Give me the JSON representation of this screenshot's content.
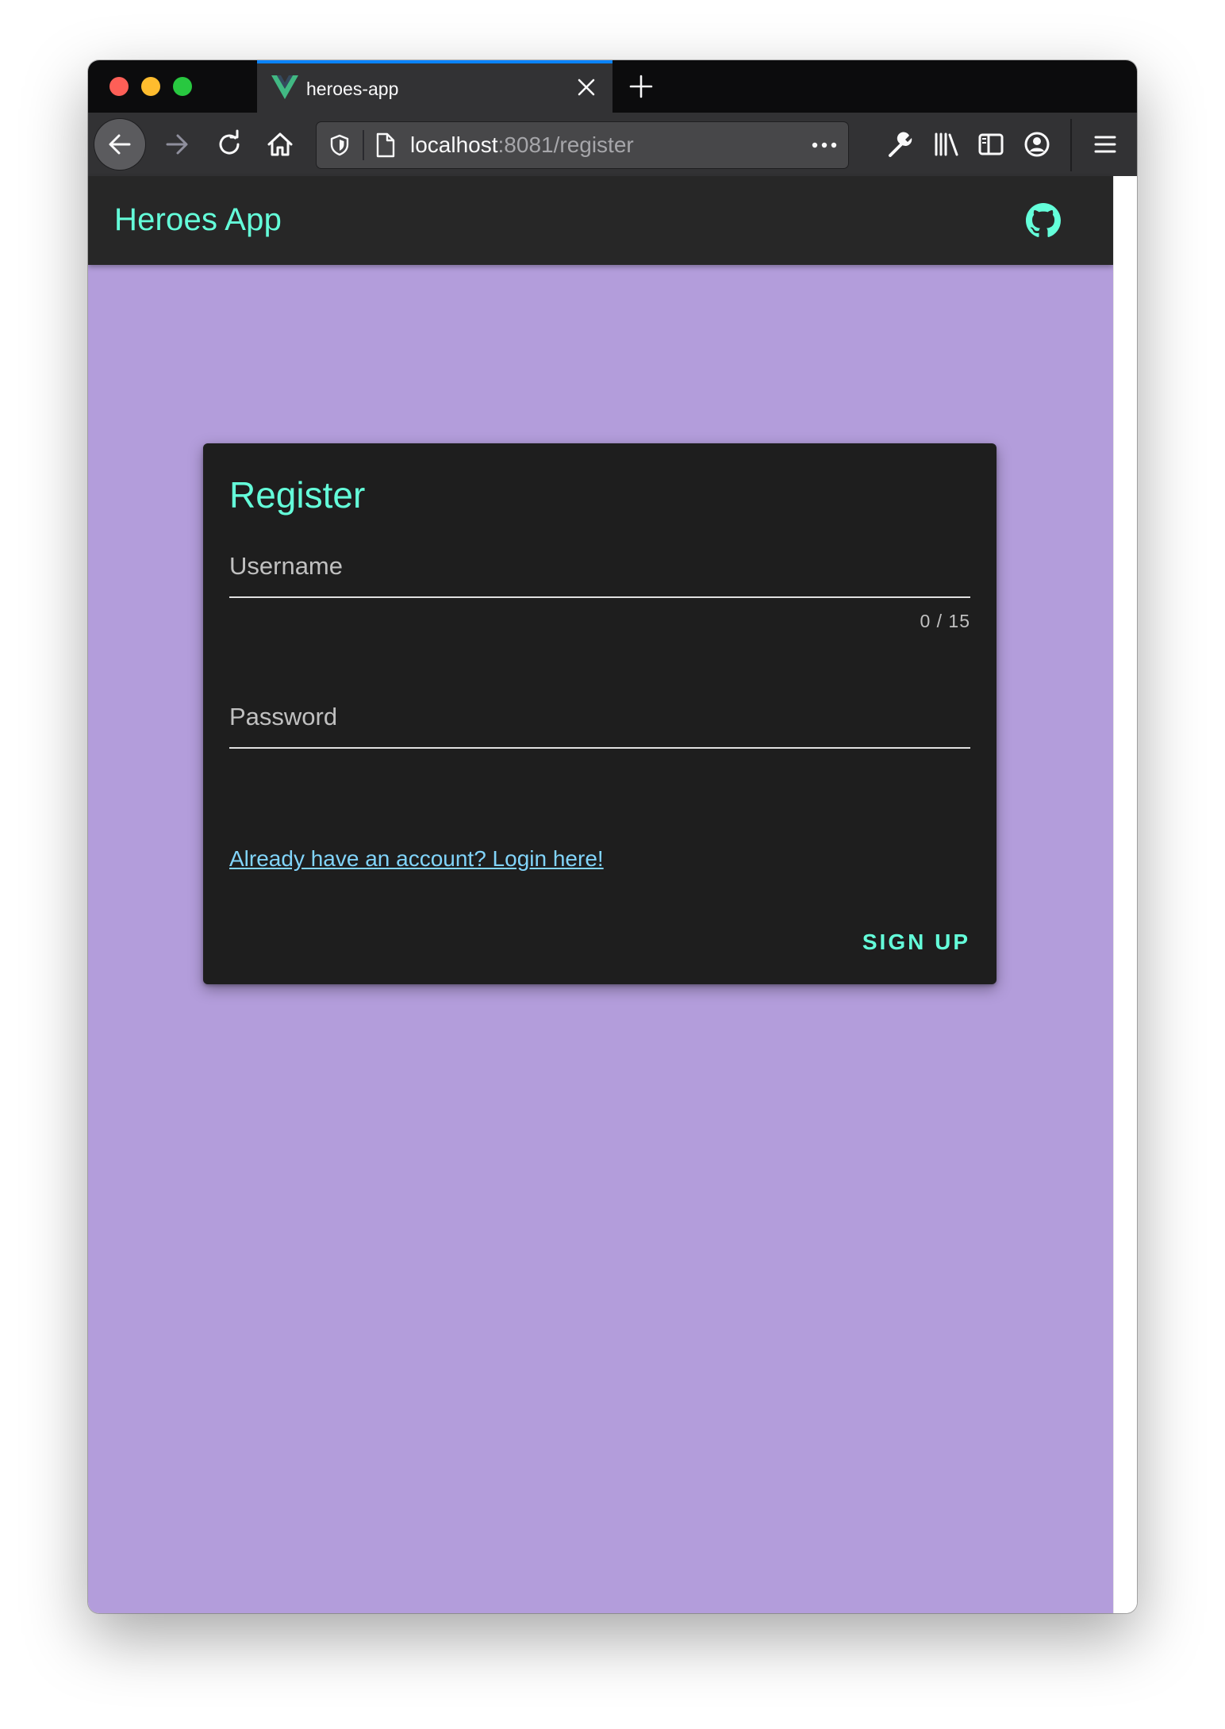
{
  "browser": {
    "tab_title": "heroes-app",
    "url_host": "localhost",
    "url_rest": ":8081/register"
  },
  "app": {
    "title": "Heroes App",
    "accent_color": "#64ffda",
    "background_color": "#b39ddb"
  },
  "register_card": {
    "title": "Register",
    "username_label": "Username",
    "username_counter": "0 / 15",
    "password_label": "Password",
    "login_link": "Already have an account? Login here!",
    "signup_button": "SIGN UP"
  }
}
